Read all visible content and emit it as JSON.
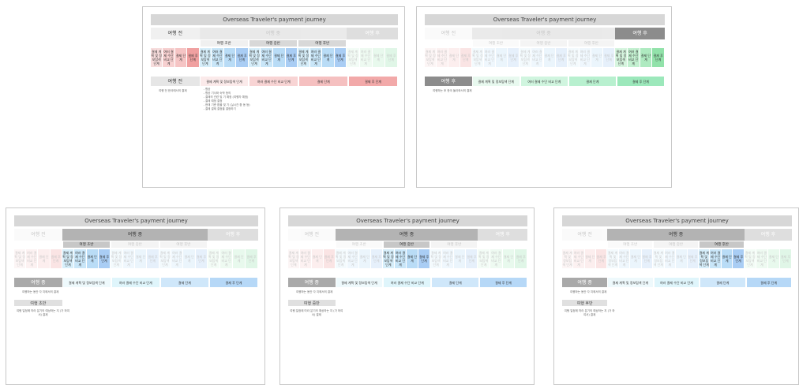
{
  "diagram": {
    "title": "Overseas Traveler's payment journey",
    "phases": [
      {
        "label": "여행 전"
      },
      {
        "label": "여행 중",
        "subphases": [
          "여행 초반",
          "여행 중반",
          "여행 후반"
        ]
      },
      {
        "label": "여행 후"
      }
    ],
    "steps": {
      "before": [
        "결제 계획 및 정보탐색 단계",
        "여러 결제 수단 비교 단계",
        "결제 단계",
        "결제 후 단계"
      ],
      "during": [
        "결제 계획 및 정보탐색 단계",
        "여러 결제 수단 비교 단계",
        "결제 단계",
        "결제 후 단계"
      ],
      "after": [
        "결제 계획 및 정보탐색 단계",
        "여러 결제 수단 비교 단계",
        "결제 단계",
        "결제 후 단계"
      ]
    },
    "detail_steps": [
      "결제 계획 및 정보탐색 단계",
      "여러 결제 수단 비교 단계",
      "결제 단계",
      "결제 후 단계"
    ],
    "descriptions": {
      "before": "여행 전 한국에서의 결제",
      "during": "여행하는 동안 각 지에서의 결제",
      "after": "여행하는 후 한국 돌아와서의 결제",
      "during_detail": "여행 일정에 따라 분기의 예상하는 지 (가 하여서) 결제"
    },
    "before_notes": "- 항공\n- 항공 기사와 숙박 등의\n- 결제의 관련 및 기 예정 (여행자 예정)\n- 결제 예정 결정\n- 현재 기준 환율 및 기 (실시간 환 동 등)\n- 결제 결제 결정을 결정하기",
    "colors": {
      "before": [
        "#f7dcdc",
        "#f7d0d0",
        "#f5c4c4",
        "#f0a0a0"
      ],
      "during": [
        "#d6eefa",
        "#c9e6f8",
        "#b9dcf6",
        "#a9cdf4"
      ],
      "after": [
        "#d6f5df",
        "#c3f0d0",
        "#aeeac0",
        "#92e2aa"
      ],
      "before_detail": [
        "#fbeaea",
        "#f8d4d4",
        "#f5c0c0",
        "#f2a9a9"
      ],
      "during_detail": [
        "#eef9fc",
        "#dff5fb",
        "#cfe7fa",
        "#b6d8f7"
      ],
      "after_detail": [
        "#e8f9ef",
        "#d0f5df",
        "#b8f0cf",
        "#9ce8bb"
      ],
      "phase_before": "#f0f0f0",
      "phase_during": "#b3b3b3",
      "phase_after": "#8c8c8c"
    }
  }
}
